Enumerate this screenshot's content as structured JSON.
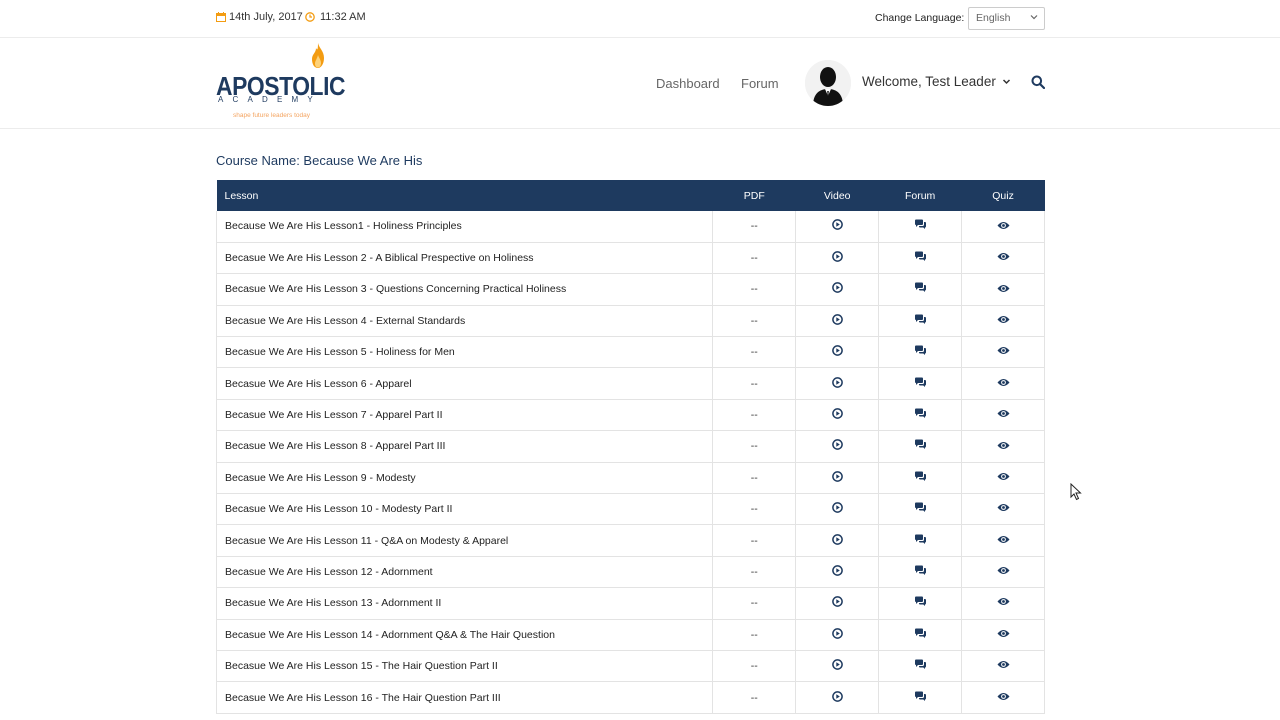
{
  "topbar": {
    "date": "14th July, 2017",
    "time": "11:32 AM",
    "change_language_label": "Change Language:",
    "language_value": "English"
  },
  "logo": {
    "name": "APOSTOLIC",
    "sub": "ACADEMY",
    "tagline": "shape future leaders today"
  },
  "nav": {
    "dashboard": "Dashboard",
    "forum": "Forum",
    "welcome": "Welcome, Test Leader"
  },
  "course": {
    "title": "Course Name: Because We Are His"
  },
  "table": {
    "headers": {
      "lesson": "Lesson",
      "pdf": "PDF",
      "video": "Video",
      "forum": "Forum",
      "quiz": "Quiz"
    },
    "rows": [
      {
        "lesson": "Because We Are His Lesson1 - Holiness Principles",
        "pdf": "--"
      },
      {
        "lesson": "Becasue We Are His Lesson 2 - A Biblical Prespective on Holiness",
        "pdf": "--"
      },
      {
        "lesson": "Becasue We Are His Lesson 3 - Questions Concerning Practical Holiness",
        "pdf": "--"
      },
      {
        "lesson": "Becasue We Are His Lesson 4 - External Standards",
        "pdf": "--"
      },
      {
        "lesson": "Becasue We Are His Lesson 5 - Holiness for Men",
        "pdf": "--"
      },
      {
        "lesson": "Becasue We Are His Lesson 6 - Apparel",
        "pdf": "--"
      },
      {
        "lesson": "Becasue We Are His Lesson 7 - Apparel Part II",
        "pdf": "--"
      },
      {
        "lesson": "Becasue We Are His Lesson 8 - Apparel Part III",
        "pdf": "--"
      },
      {
        "lesson": "Becasue We Are His Lesson 9 - Modesty",
        "pdf": "--"
      },
      {
        "lesson": "Becasue We Are His Lesson 10 - Modesty Part II",
        "pdf": "--"
      },
      {
        "lesson": "Becasue We Are His Lesson 11 - Q&A on Modesty & Apparel",
        "pdf": "--"
      },
      {
        "lesson": "Becasue We Are His Lesson 12 - Adornment",
        "pdf": "--"
      },
      {
        "lesson": "Becasue We Are His Lesson 13 - Adornment II",
        "pdf": "--"
      },
      {
        "lesson": "Becasue We Are His Lesson 14 - Adornment Q&A & The Hair Question",
        "pdf": "--"
      },
      {
        "lesson": "Becasue We Are His Lesson 15 - The Hair Question Part II",
        "pdf": "--"
      },
      {
        "lesson": "Becasue We Are His Lesson 16 - The Hair Question Part III",
        "pdf": "--"
      }
    ]
  },
  "icons": {
    "video": "play-circle-icon",
    "forum": "comments-icon",
    "quiz": "eye-icon"
  },
  "colors": {
    "primary": "#1e3a5f",
    "accent": "#f39c12"
  }
}
